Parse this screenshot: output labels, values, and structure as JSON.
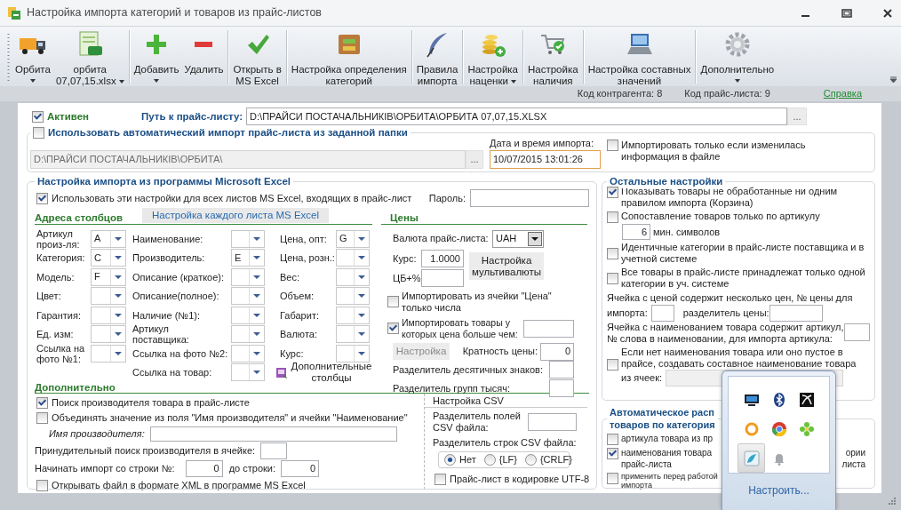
{
  "window": {
    "title": "Настройка импорта категорий и товаров из прайс-листов"
  },
  "toolbar": [
    {
      "lines": [
        "Орбита"
      ],
      "dropdown": true,
      "separator_before": false
    },
    {
      "lines": [
        "орбита",
        "07,07,15.xlsx"
      ],
      "dropdown": true,
      "separator_before": false
    },
    {
      "lines": [
        "Добавить"
      ],
      "dropdown": true,
      "separator_before": true
    },
    {
      "lines": [
        "Удалить"
      ],
      "dropdown": false,
      "separator_before": false
    },
    {
      "lines": [
        "Открыть в",
        "MS Excel"
      ],
      "dropdown": false,
      "separator_before": true
    },
    {
      "lines": [
        "Настройка определения",
        "категорий"
      ],
      "dropdown": false,
      "separator_before": true
    },
    {
      "lines": [
        "Правила",
        "импорта"
      ],
      "dropdown": false,
      "separator_before": true
    },
    {
      "lines": [
        "Настройка",
        "наценки"
      ],
      "dropdown": true,
      "separator_before": true
    },
    {
      "lines": [
        "Настройка",
        "наличия"
      ],
      "dropdown": false,
      "separator_before": true
    },
    {
      "lines": [
        "Настройка составных",
        "значений"
      ],
      "dropdown": false,
      "separator_before": true
    },
    {
      "lines": [
        "Дополнительно"
      ],
      "dropdown": true,
      "separator_before": true
    }
  ],
  "status": {
    "contractor": "Код контрагента: 8",
    "price_list": "Код прайс-листа: 9",
    "help": "Справка"
  },
  "active": {
    "label": "Активен",
    "checked": true
  },
  "path": {
    "label": "Путь к прайс-листу:",
    "value": "D:\\ПРАЙСИ ПОСТАЧАЛЬНИКІВ\\ОРБИТА\\ОРБИТА 07,07,15.XLSX",
    "browse": "..."
  },
  "auto_import": {
    "label": "Использовать автоматический импорт прайс-листа из заданной папки",
    "checked": false,
    "folder": "D:\\ПРАЙСИ ПОСТАЧАЛЬНИКІВ\\ОРБИТА\\",
    "browse": "...",
    "date_label": "Дата и время импорта:",
    "date": "10/07/2015 13:01:26",
    "only_changed": {
      "label": "Импортировать только если изменилась информация в файле",
      "checked": false
    }
  },
  "excel": {
    "title": "Настройка импорта из программы Microsoft Excel",
    "use_all": {
      "label": "Использовать эти настройки для всех листов MS Excel, входящих в прайс-лист",
      "checked": true
    },
    "password_label": "Пароль:",
    "columns_title": "Адреса столбцов",
    "sheet_button": "Настройка каждого листа MS Excel",
    "columns": [
      [
        {
          "label_lines": [
            "Артикул",
            "произ-ля:"
          ],
          "value": "A"
        },
        {
          "label_lines": [
            "Категория:"
          ],
          "value": "C"
        },
        {
          "label_lines": [
            "Модель:"
          ],
          "value": "F"
        },
        {
          "label_lines": [
            "Цвет:"
          ]
        },
        {
          "label_lines": [
            "Гарантия:"
          ]
        },
        {
          "label_lines": [
            "Ед. изм:"
          ]
        },
        {
          "label_lines": [
            "Ссылка на",
            "фото №1:"
          ]
        }
      ],
      [
        {
          "label_lines": [
            "Наименование:"
          ]
        },
        {
          "label_lines": [
            "Производитель:"
          ],
          "value": "E"
        },
        {
          "label_lines": [
            "Описание (краткое):"
          ]
        },
        {
          "label_lines": [
            "Описание(полное):"
          ]
        },
        {
          "label_lines": [
            "Наличие (№1):"
          ]
        },
        {
          "label_lines": [
            "Артикул",
            "поставщика:"
          ]
        },
        {
          "label_lines": [
            "Ссылка на фото №2:"
          ]
        },
        {
          "label_lines": [
            "Ссылка на товар:"
          ]
        }
      ],
      [
        {
          "label_lines": [
            "Цена, опт:"
          ],
          "value": "G"
        },
        {
          "label_lines": [
            "Цена, розн.:"
          ]
        },
        {
          "label_lines": [
            "Вес:"
          ]
        },
        {
          "label_lines": [
            "Объем:"
          ]
        },
        {
          "label_lines": [
            "Габарит:"
          ]
        },
        {
          "label_lines": [
            "Валюта:"
          ]
        },
        {
          "label_lines": [
            "Курс:"
          ]
        }
      ]
    ],
    "extra_columns": "Дополнительные столбцы",
    "prices": {
      "title": "Цены",
      "currency_label": "Валюта прайс-листа:",
      "currency": "UAH",
      "rate_label": "Курс:",
      "rate": "1.0000",
      "cb_label": "ЦБ+%",
      "multi_button": "Настройка мультивалюты",
      "numbers_only": {
        "label": "Импортировать из ячейки \"Цена\" только числа",
        "checked": false
      },
      "above": {
        "label": "Импортировать товары у которых цена больше чем:",
        "checked": true
      },
      "setup_button": {
        "label": "Настройка",
        "disabled": true
      },
      "multiple_label": "Кратность цены:",
      "multiple": "0",
      "decimal_label": "Разделитель десятичных знаков:",
      "thousands_label": "Разделитель групп тысяч:"
    },
    "extra": {
      "title": "Дополнительно",
      "search_manufacturer": {
        "label": "Поиск производителя товара в прайс-листе",
        "checked": true
      },
      "combine": {
        "label": "Объединять значение из поля \"Имя производителя\" и ячейки \"Наименование\"",
        "checked": false
      },
      "manufacturer_label": "Имя производителя:",
      "forced_label": "Принудительный поиск производителя в ячейке:",
      "start_label": "Начинать импорт со строки №:",
      "start": "0",
      "end_label": "до строки:",
      "end": "0",
      "open_xml": {
        "label": "Открывать файл в формате XML в программе MS Excel",
        "checked": false
      }
    },
    "csv": {
      "title": "Настройка CSV",
      "field_sep_label": "Разделитель полей CSV файла:",
      "row_sep_label": "Разделитель строк CSV файла:",
      "row_sep": [
        {
          "label": "Нет",
          "selected": true
        },
        {
          "label": "{LF}",
          "selected": false
        },
        {
          "label": "{CRLF}",
          "selected": false
        }
      ],
      "utf8": {
        "label": "Прайс-лист в кодировке UTF-8",
        "checked": false
      }
    }
  },
  "other": {
    "title": "Остальные настройки",
    "show_unprocessed": {
      "label": "Показывать товары не обработанные ни одним правилом импорта (Корзина)",
      "checked": true
    },
    "match_by_article": {
      "label": "Сопоставление товаров только по артикулу",
      "checked": false
    },
    "min_symbols": {
      "value": "6",
      "label": "мин. символов"
    },
    "identical_categories": {
      "label": "Идентичные категории в прайс-листе поставщика и в учетной системе",
      "checked": false
    },
    "single_category": {
      "label": "Все товары в прайс-листе принадлежат только одной категории в уч. системе",
      "checked": false
    },
    "multi_price_lines": [
      "Ячейка с ценой содержит несколько цен, № цены для",
      "импорта:"
    ],
    "price_sep_label": "разделитель цены:",
    "article_in_name_label": "Ячейка с наименованием товара содержит артикул, № слова в наименовании, для импорта артикула:",
    "compose_name": {
      "label_lines": [
        "Если нет наименования товара или оно пустое в",
        "прайсе, создавать составное наименование товара",
        "из ячеек:"
      ],
      "checked": false
    }
  },
  "auto_dist": {
    "title_lines": [
      "Автоматическое расп",
      "товаров по категория"
    ],
    "items": [
      {
        "checked": false,
        "small": false,
        "lines": [
          {
            "left": "артикула товара из пр"
          }
        ]
      },
      {
        "checked": true,
        "small": false,
        "lines": [
          {
            "left": "наименования товара",
            "right": "ории"
          },
          {
            "left": "прайс-листа",
            "right": "листа"
          }
        ]
      },
      {
        "checked": false,
        "small": true,
        "lines": [
          {
            "left": "применить перед работой"
          },
          {
            "left": "импорта"
          }
        ]
      }
    ]
  },
  "tray": {
    "icons": [
      {
        "selected": false
      },
      {
        "selected": false
      },
      {
        "selected": false
      },
      {
        "selected": false
      },
      {
        "selected": false
      },
      {
        "selected": false
      },
      {
        "selected": true
      },
      {
        "selected": false
      }
    ],
    "customize": "Настроить..."
  }
}
